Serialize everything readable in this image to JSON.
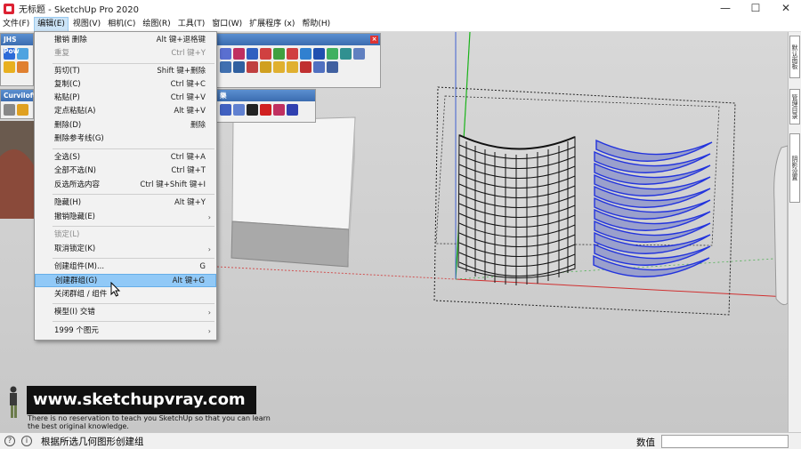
{
  "window": {
    "title": "无标题 - SketchUp Pro 2020",
    "minimize": "—",
    "maximize": "☐",
    "close": "✕"
  },
  "menubar": [
    "文件(F)",
    "编辑(E)",
    "视图(V)",
    "相机(C)",
    "绘图(R)",
    "工具(T)",
    "窗口(W)",
    "扩展程序 (x)",
    "帮助(H)"
  ],
  "toolbars": {
    "jhs": "JHS Pow",
    "curviloft": "Curviloft",
    "third": "樂"
  },
  "edit_menu": {
    "items": [
      {
        "label": "撤销 删除",
        "shortcut": "Alt 键+退格键",
        "disabled": false
      },
      {
        "label": "重复",
        "shortcut": "Ctrl 键+Y",
        "disabled": true
      },
      {
        "label": "剪切(T)",
        "shortcut": "Shift 键+删除",
        "disabled": false
      },
      {
        "label": "复制(C)",
        "shortcut": "Ctrl 键+C",
        "disabled": false
      },
      {
        "label": "粘贴(P)",
        "shortcut": "Ctrl 键+V",
        "disabled": false
      },
      {
        "label": "定点粘贴(A)",
        "shortcut": "Alt 键+V",
        "disabled": false
      },
      {
        "label": "删除(D)",
        "shortcut": "删除",
        "disabled": false
      },
      {
        "label": "删除参考线(G)",
        "shortcut": "",
        "disabled": false
      },
      {
        "label": "全选(S)",
        "shortcut": "Ctrl 键+A",
        "disabled": false
      },
      {
        "label": "全部不选(N)",
        "shortcut": "Ctrl 键+T",
        "disabled": false
      },
      {
        "label": "反选所选内容",
        "shortcut": "Ctrl 键+Shift 键+I",
        "disabled": false
      },
      {
        "label": "隐藏(H)",
        "shortcut": "Alt 键+Y",
        "disabled": false
      },
      {
        "label": "撤销隐藏(E)",
        "shortcut": "",
        "disabled": false,
        "submenu": true
      },
      {
        "label": "锁定(L)",
        "shortcut": "",
        "disabled": true
      },
      {
        "label": "取消锁定(K)",
        "shortcut": "",
        "disabled": false,
        "submenu": true
      },
      {
        "label": "创建组件(M)...",
        "shortcut": "G",
        "disabled": false
      },
      {
        "label": "创建群组(G)",
        "shortcut": "Alt 键+G",
        "disabled": false,
        "highlighted": true
      },
      {
        "label": "关闭群组 / 组件",
        "shortcut": "",
        "disabled": false
      },
      {
        "label": "模型(I) 交错",
        "shortcut": "",
        "disabled": false,
        "submenu": true
      },
      {
        "label": "1999 个图元",
        "shortcut": "",
        "disabled": false,
        "submenu": true
      }
    ]
  },
  "right_tabs": [
    "默认面板",
    "管理目录",
    "阴影设置"
  ],
  "watermark": {
    "url": "www.sketchupvray.com",
    "line1": "There is no reservation to teach you SketchUp so that you can learn",
    "line2": "the best original knowledge."
  },
  "statusbar": {
    "text": "根据所选几何图形创建组",
    "measure_label": "数值",
    "measure_value": ""
  }
}
